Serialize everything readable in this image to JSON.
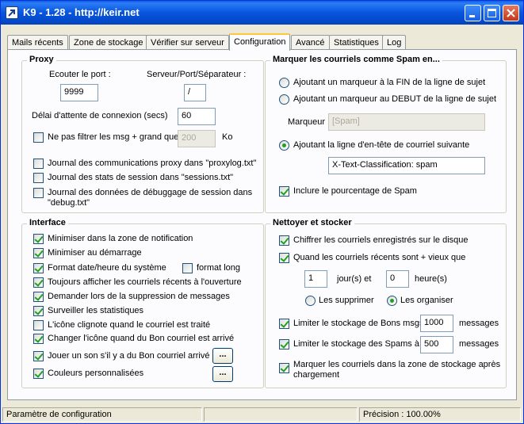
{
  "window": {
    "title": "K9 - 1.28 - http://keir.net"
  },
  "tabs": [
    "Mails récents",
    "Zone de stockage",
    "Vérifier sur serveur",
    "Configuration",
    "Avancé",
    "Statistiques",
    "Log"
  ],
  "proxy": {
    "title": "Proxy",
    "port_label": "Ecouter le port :",
    "port_value": "9999",
    "server_label": "Serveur/Port/Séparateur :",
    "separator_value": "/",
    "timeout_label": "Délai d'attente de connexion (secs)",
    "timeout_value": "60",
    "nofilter_label": "Ne pas filtrer les msg + grand que",
    "nofilter_value": "200",
    "nofilter_unit": "Ko",
    "log_proxy": "Journal des communications proxy dans \"proxylog.txt\"",
    "log_sessions": "Journal des stats de session dans \"sessions.txt\"",
    "log_debug": "Journal des données de débuggage de session dans \"debug.txt\""
  },
  "spam": {
    "title": "Marquer les courriels comme Spam en...",
    "radio_end": "Ajoutant un marqueur à la FIN de la ligne de sujet",
    "radio_start": "Ajoutant un marqueur au DEBUT de la ligne de sujet",
    "marker_label": "Marqueur",
    "marker_value": "[Spam]",
    "radio_header": "Ajoutant la ligne d'en-tête de courriel  suivante",
    "header_value": "X-Text-Classification: spam",
    "include_pct": "Inclure le pourcentage de Spam"
  },
  "interface": {
    "title": "Interface",
    "items": [
      "Minimiser dans la zone de notification",
      "Minimiser au démarrage",
      "Format date/heure du système",
      "Toujours afficher les courriels récents à l'ouverture",
      "Demander lors de la suppression de messages",
      "Surveiller les statistiques",
      "L'icône clignote quand le courriel est traité",
      "Changer l'icône quand du Bon courriel est arrivé",
      "Jouer un son s'il y a du Bon courriel arrivé",
      "Couleurs personnalisées"
    ],
    "long_format": "format long",
    "ellipsis": "..."
  },
  "cleanup": {
    "title": "Nettoyer et stocker",
    "encrypt": "Chiffrer les courriels enregistrés sur le disque",
    "when_older": "Quand les courriels récents sont + vieux que",
    "days_value": "1",
    "days_label": "jour(s) et",
    "hours_value": "0",
    "hours_label": "heure(s)",
    "delete_label": "Les supprimer",
    "organize_label": "Les organiser",
    "limit_good": "Limiter le stockage de Bons msgs",
    "limit_good_value": "1000",
    "limit_spam": "Limiter le stockage des Spams à",
    "limit_spam_value": "500",
    "messages_unit": "messages",
    "mark_in_storage": "Marquer les courriels dans la zone de stockage après chargement"
  },
  "status": {
    "left": "Paramètre de configuration",
    "right": "Précision : 100.00%"
  }
}
